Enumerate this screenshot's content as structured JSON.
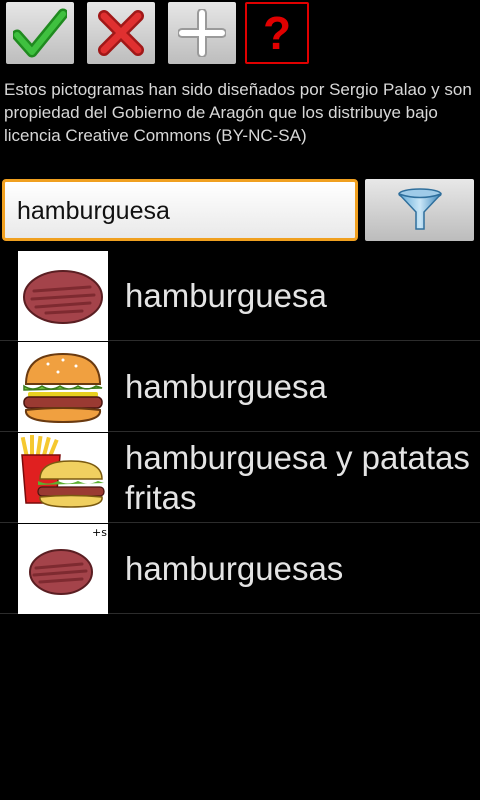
{
  "toolbar": {
    "buttons": [
      {
        "id": "accept",
        "icon": "check-icon",
        "color": "#2aa02a"
      },
      {
        "id": "cancel",
        "icon": "x-icon",
        "color": "#cc2020"
      },
      {
        "id": "add",
        "icon": "plus-icon",
        "color": "#ffffff"
      },
      {
        "id": "help",
        "icon": "question-icon",
        "text": "?",
        "color": "#e00000"
      }
    ]
  },
  "credits": "Estos pictogramas han sido diseñados por Sergio Palao y son propiedad del Gobierno de Aragón que los distribuye bajo licencia Creative Commons (BY-NC-SA)",
  "search": {
    "value": "hamburguesa",
    "accent": "#f0a020"
  },
  "filter": {
    "icon": "funnel-icon"
  },
  "results": [
    {
      "label": "hamburguesa",
      "pictogram": "hamburger-patty-icon"
    },
    {
      "label": "hamburguesa",
      "pictogram": "hamburger-icon"
    },
    {
      "label": "hamburguesa y patatas fritas",
      "pictogram": "hamburger-fries-icon"
    },
    {
      "label": "hamburguesas",
      "pictogram": "hamburger-patties-plural-icon",
      "badge": "+s"
    }
  ]
}
